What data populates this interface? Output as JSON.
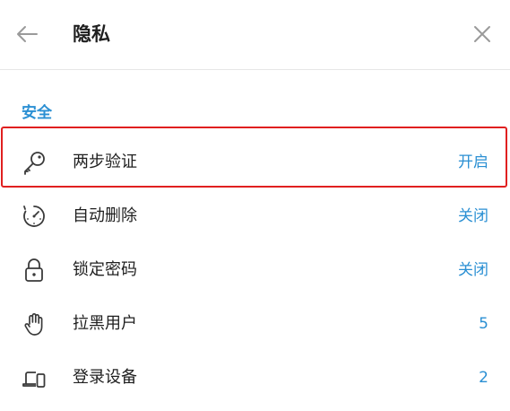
{
  "header": {
    "back_icon": "arrow-left-icon",
    "title": "隐私",
    "close_icon": "close-icon"
  },
  "section": {
    "title": "安全"
  },
  "items": [
    {
      "label": "两步验证",
      "value": "开启",
      "icon": "key-icon"
    },
    {
      "label": "自动删除",
      "value": "关闭",
      "icon": "timer-icon"
    },
    {
      "label": "锁定密码",
      "value": "关闭",
      "icon": "lock-icon"
    },
    {
      "label": "拉黑用户",
      "value": "5",
      "icon": "hand-icon"
    },
    {
      "label": "登录设备",
      "value": "2",
      "icon": "devices-icon"
    }
  ],
  "colors": {
    "accent": "#2a8fd3",
    "highlight": "#e02020",
    "icon": "#3a3a3a",
    "muted_icon": "#9a9a9a"
  }
}
